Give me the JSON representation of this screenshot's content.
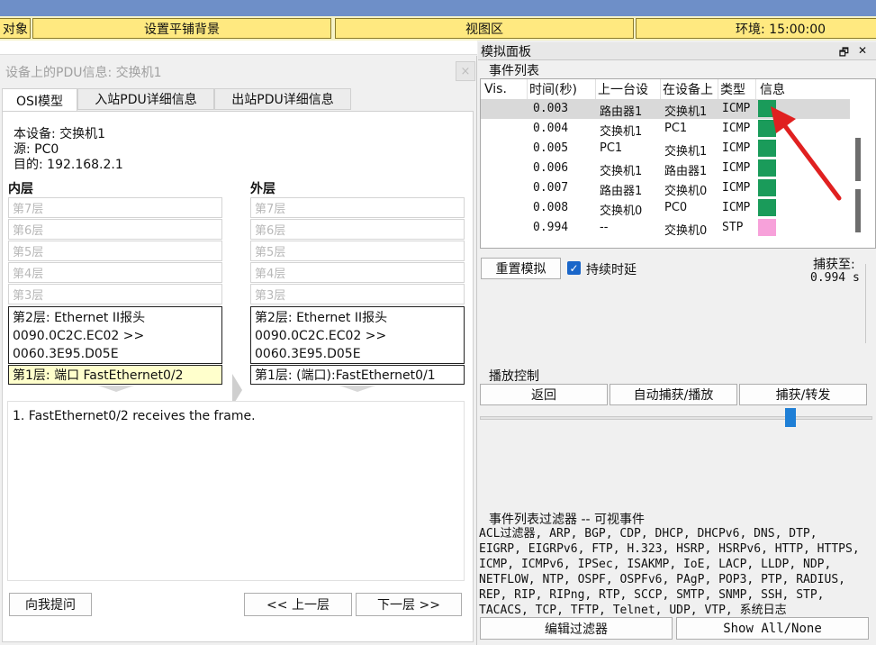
{
  "toolbar": {
    "btn_objects": "对象",
    "btn_tile_bg": "设置平铺背景",
    "btn_viewport": "视图区",
    "btn_env": "环境: 15:00:00"
  },
  "pdu": {
    "title": "设备上的PDU信息: 交换机1",
    "close": "×",
    "tabs": [
      "OSI模型",
      "入站PDU详细信息",
      "出站PDU详细信息"
    ],
    "info": {
      "device": "本设备: 交换机1",
      "source": "源: PC0",
      "dest": "目的: 192.168.2.1"
    },
    "inner_label": "内层",
    "outer_label": "外层",
    "inner_layers": [
      "第7层",
      "第6层",
      "第5层",
      "第4层",
      "第3层"
    ],
    "outer_layers": [
      "第7层",
      "第6层",
      "第5层",
      "第4层",
      "第3层"
    ],
    "inner_l2": [
      "第2层: Ethernet II报头",
      "0090.0C2C.EC02 >>",
      "0060.3E95.D05E"
    ],
    "outer_l2": [
      "第2层: Ethernet II报头",
      "0090.0C2C.EC02 >>",
      "0060.3E95.D05E"
    ],
    "inner_l1": "第1层: 端口 FastEthernet0/2",
    "outer_l1": "第1层: (端口):FastEthernet0/1",
    "description": "1. FastEthernet0/2 receives the frame.",
    "btn_challenge": "向我提问",
    "btn_prev": "<< 上一层",
    "btn_next": "下一层 >>"
  },
  "sim": {
    "title": "模拟面板",
    "icon_restore": "🗗",
    "icon_close": "✕",
    "event_list_label": "事件列表",
    "columns": [
      "Vis.",
      "时间(秒)",
      "上一台设",
      "在设备上",
      "类型",
      "信息"
    ],
    "events": [
      {
        "time": "0.003",
        "last": "路由器1",
        "at": "交换机1",
        "type": "ICMP",
        "color": "#1a9b5a",
        "selected": true
      },
      {
        "time": "0.004",
        "last": "交换机1",
        "at": "PC1",
        "type": "ICMP",
        "color": "#1a9b5a",
        "selected": false
      },
      {
        "time": "0.005",
        "last": "PC1",
        "at": "交换机1",
        "type": "ICMP",
        "color": "#1a9b5a",
        "selected": false
      },
      {
        "time": "0.006",
        "last": "交换机1",
        "at": "路由器1",
        "type": "ICMP",
        "color": "#1a9b5a",
        "selected": false
      },
      {
        "time": "0.007",
        "last": "路由器1",
        "at": "交换机0",
        "type": "ICMP",
        "color": "#1a9b5a",
        "selected": false
      },
      {
        "time": "0.008",
        "last": "交换机0",
        "at": "PC0",
        "type": "ICMP",
        "color": "#1a9b5a",
        "selected": false
      },
      {
        "time": "0.994",
        "last": "--",
        "at": "交换机0",
        "type": "STP",
        "color": "#f7a1da",
        "selected": false
      }
    ],
    "btn_reset": "重置模拟",
    "constant_delay_label": "持续时延",
    "constant_delay_checked": true,
    "captured_label": "捕获至:",
    "captured_value": "0.994 s",
    "playback_label": "播放控制",
    "btn_back": "返回",
    "btn_auto": "自动捕获/播放",
    "btn_capture": "捕获/转发",
    "filter_title": "事件列表过滤器 -- 可视事件",
    "filter_lines": [
      "ACL过滤器, ARP, BGP, CDP, DHCP, DHCPv6, DNS, DTP,",
      "EIGRP, EIGRPv6, FTP, H.323, HSRP, HSRPv6, HTTP, HTTPS,",
      "ICMP, ICMPv6, IPSec, ISAKMP, IoE, LACP, LLDP, NDP,",
      "NETFLOW, NTP, OSPF, OSPFv6, PAgP, POP3, PTP, RADIUS,",
      "REP, RIP, RIPng, RTP, SCCP, SMTP, SNMP, SSH, STP,",
      "TACACS, TCP, TFTP, Telnet, UDP, VTP, 系统日志"
    ],
    "btn_edit_filters": "编辑过滤器",
    "btn_show_all": "Show All/None"
  },
  "colors": {
    "icmp": "#1a9b5a",
    "stp": "#f7a1da",
    "arrow": "#e02020",
    "slider": "#1f7fd6"
  }
}
